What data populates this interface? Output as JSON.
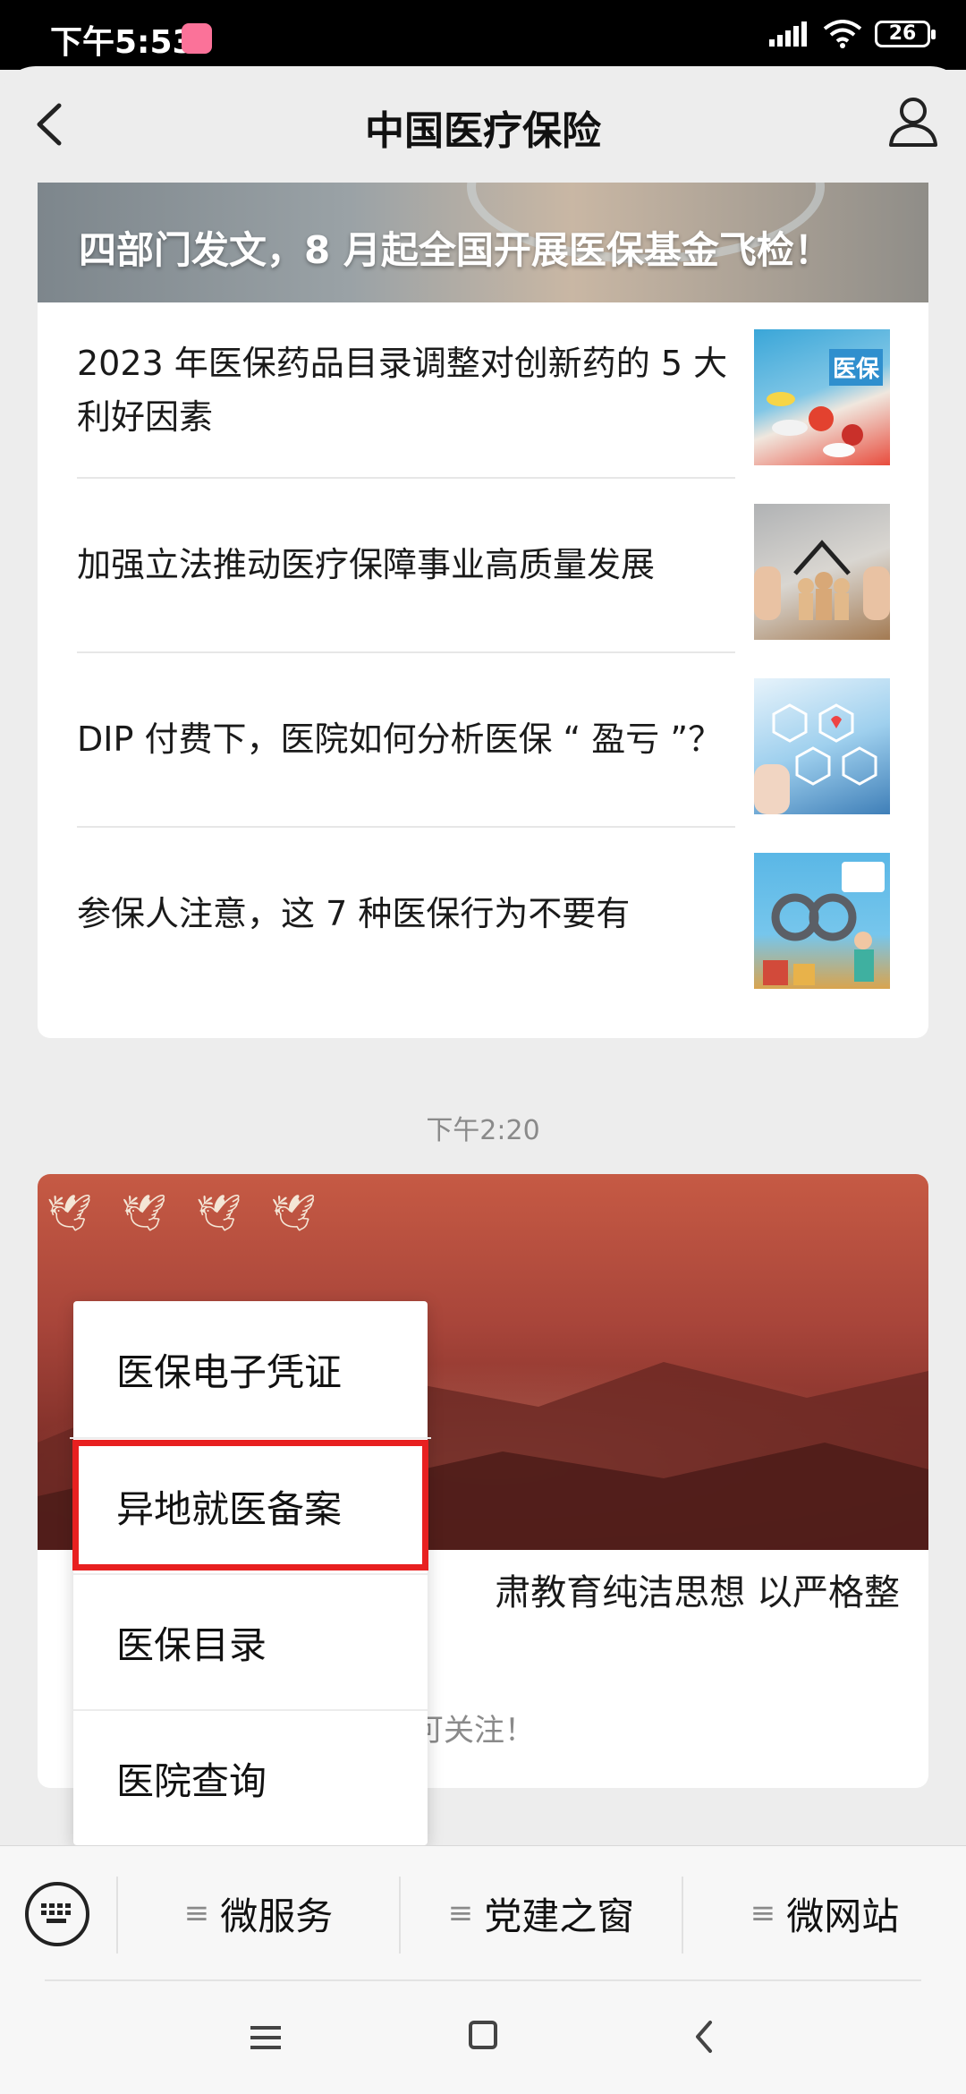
{
  "status_bar": {
    "time": "下午5:53",
    "battery": "26"
  },
  "header": {
    "title": "中国医疗保险"
  },
  "article_card": {
    "banner_title": "四部门发文，8 月起全国开展医保基金飞检！",
    "items": [
      {
        "title": "2023 年医保药品目录调整对创新药的 5 大利好因素",
        "thumb_text": "医保"
      },
      {
        "title": "加强立法推动医疗保障事业高质量发展"
      },
      {
        "title": "DIP 付费下，医院如何分析医保 “ 盈亏 ”？"
      },
      {
        "title": "参保人注意，这 7 种医保行为不要有"
      }
    ]
  },
  "chat_time": "下午2:20",
  "second_card": {
    "title_visible": "肃教育纯洁思想 以严格整",
    "subtitle_visible": "可关注！"
  },
  "popup_menu": {
    "items": [
      {
        "label": "医保电子凭证"
      },
      {
        "label": "异地就医备案",
        "highlighted": true
      },
      {
        "label": "医保目录"
      },
      {
        "label": "医院查询"
      }
    ]
  },
  "bottom_menu": {
    "tabs": [
      {
        "label": "微服务"
      },
      {
        "label": "党建之窗"
      },
      {
        "label": "微网站"
      }
    ]
  },
  "colors": {
    "highlight": "#e82020",
    "background": "#ededed"
  }
}
